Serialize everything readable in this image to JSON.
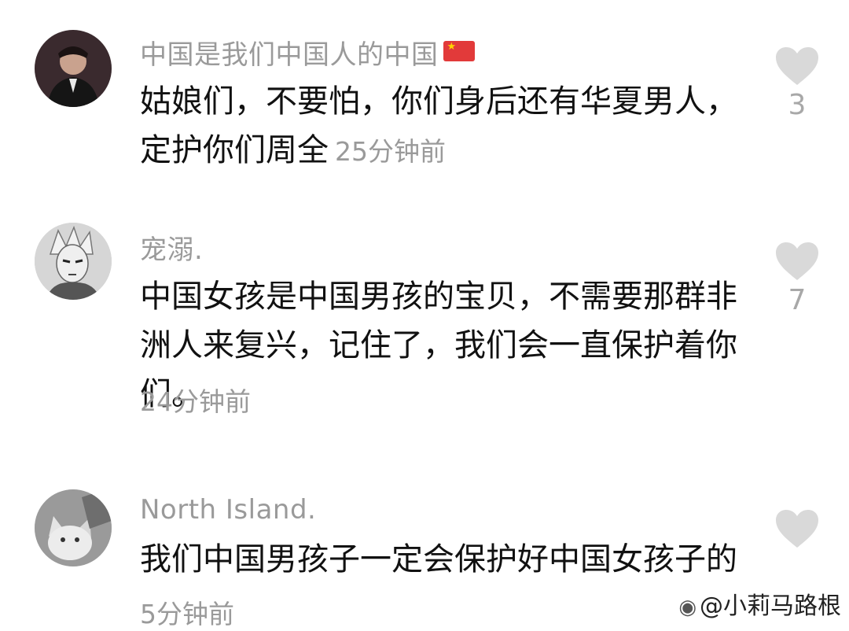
{
  "comments": [
    {
      "username": "中国是我们中国人的中国",
      "text": "姑娘们，不要怕，你们身后还有华夏男人，定护你们周全",
      "time": "25分钟前",
      "likes": "3",
      "avatar_icon": "avatar-man-in-suit"
    },
    {
      "username": "宠溺.",
      "text": "中国女孩是中国男孩的宝贝，不需要那群非洲人来复兴，记住了，我们会一直保护着你们。",
      "time": "24分钟前",
      "likes": "7",
      "avatar_icon": "avatar-anime-character"
    },
    {
      "username": "North Island.",
      "text": "我们中国男孩子一定会保护好中国女孩子的",
      "time": "5分钟前",
      "likes": "",
      "avatar_icon": "avatar-cat"
    }
  ],
  "watermark": "@小莉马路根",
  "icons": {
    "like": "heart-icon",
    "flag": "china-flag-icon",
    "weibo": "weibo-logo-icon"
  },
  "colors": {
    "username": "#9a9a9a",
    "text": "#111111",
    "heart": "#d9d9d9",
    "flag": "#e23a3a"
  }
}
